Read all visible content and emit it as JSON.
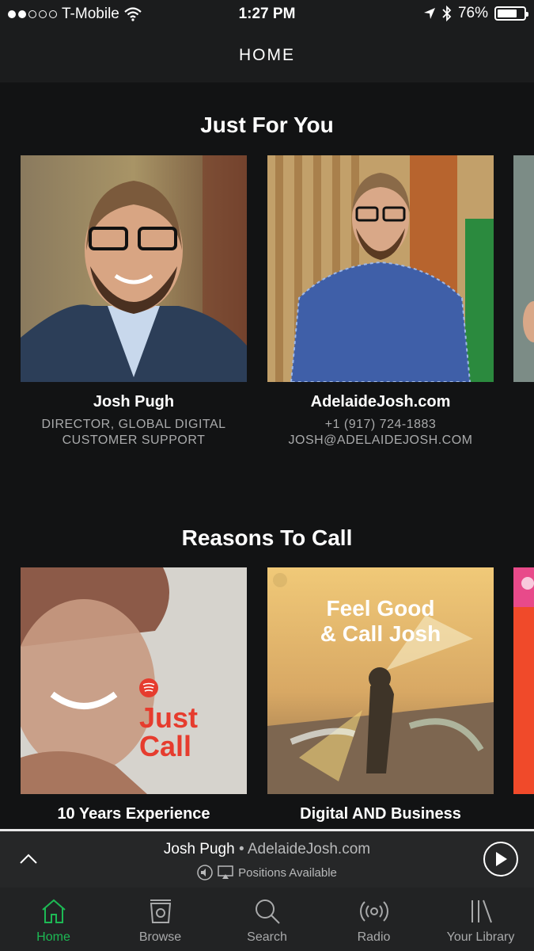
{
  "status_bar": {
    "carrier": "T-Mobile",
    "time": "1:27 PM",
    "battery": "76%",
    "battery_level": 0.76
  },
  "header": {
    "title": "HOME"
  },
  "section1": {
    "title": "Just For You",
    "cards": [
      {
        "name": "Josh Pugh",
        "sub1": "DIRECTOR, GLOBAL DIGITAL",
        "sub2": "CUSTOMER SUPPORT"
      },
      {
        "name": "AdelaideJosh.com",
        "sub1": "+1 (917) 724-1883",
        "sub2": "JOSH@ADELAIDEJOSH.COM"
      }
    ]
  },
  "section2": {
    "title": "Reasons To Call",
    "cards": [
      {
        "name": "10 Years Experience",
        "art_line1": "Just",
        "art_line2": "Call"
      },
      {
        "name": "Digital AND Business",
        "art_line1": "Feel Good",
        "art_line2": "& Call Josh"
      }
    ]
  },
  "now_playing": {
    "title": "Josh Pugh",
    "separator": " • ",
    "artist": "AdelaideJosh.com",
    "device": "Positions Available"
  },
  "tabs": [
    {
      "label": "Home",
      "icon": "home-icon",
      "active": true
    },
    {
      "label": "Browse",
      "icon": "browse-icon"
    },
    {
      "label": "Search",
      "icon": "search-icon"
    },
    {
      "label": "Radio",
      "icon": "radio-icon"
    },
    {
      "label": "Your Library",
      "icon": "library-icon"
    }
  ],
  "colors": {
    "accent": "#1db954",
    "background": "#121314"
  }
}
